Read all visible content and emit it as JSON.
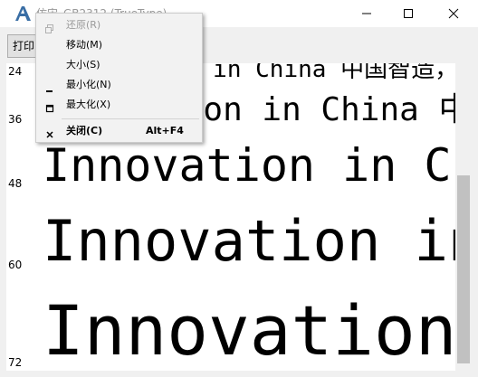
{
  "window": {
    "title": "仿宋_GB2312 (TrueType)",
    "print_label": "打印(P)"
  },
  "preview": {
    "rows": [
      {
        "size": "24",
        "text": "Innovation in China 中国智造，"
      },
      {
        "size": "36",
        "text": "Innovation in China 中国智造"
      },
      {
        "size": "48",
        "text": "Innovation in China"
      },
      {
        "size": "60",
        "text": "Innovation in China"
      },
      {
        "size": "72",
        "text": "Innovation in China"
      }
    ]
  },
  "menu": {
    "items": [
      {
        "label": "还原(R)",
        "icon": "restore-icon",
        "enabled": false
      },
      {
        "label": "移动(M)",
        "icon": "",
        "enabled": true
      },
      {
        "label": "大小(S)",
        "icon": "",
        "enabled": true
      },
      {
        "label": "最小化(N)",
        "icon": "minimize-icon",
        "enabled": true
      },
      {
        "label": "最大化(X)",
        "icon": "maximize-icon",
        "enabled": true
      },
      {
        "label": "关闭(C)",
        "icon": "close-icon",
        "enabled": true,
        "shortcut": "Alt+F4",
        "bold": true
      }
    ]
  }
}
